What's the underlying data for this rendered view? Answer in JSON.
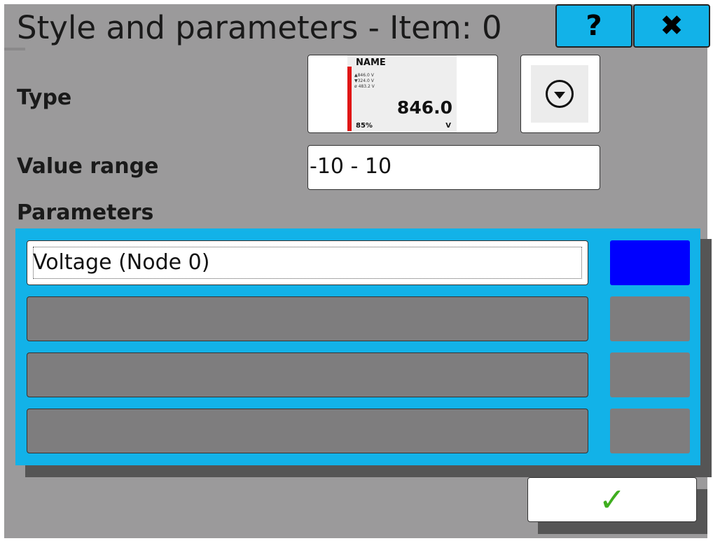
{
  "header": {
    "title": "Style and parameters - Item: 0",
    "help_label": "?",
    "close_label": "✖"
  },
  "type": {
    "label": "Type",
    "preview": {
      "name": "NAME",
      "max": "▲846.0 V",
      "min": "▼324.0 V",
      "avg": "ø 483.2 V",
      "value": "846.0",
      "percent": "85%",
      "unit": "V",
      "bar_fill_fraction": 0.85
    },
    "dropdown_icon": "chevron-down-circle-icon"
  },
  "value_range": {
    "label": "Value range",
    "value": "-10 - 10"
  },
  "parameters": {
    "label": "Parameters",
    "rows": [
      {
        "text": "Voltage (Node 0)",
        "color": "#0000ff"
      },
      {
        "text": "",
        "color": "#7e7d7e"
      },
      {
        "text": "",
        "color": "#7e7d7e"
      },
      {
        "text": "",
        "color": "#7e7d7e"
      }
    ]
  },
  "ok_label": "✓",
  "colors": {
    "accent": "#12b2e8",
    "background": "#9b9a9b",
    "bar": "#e01515",
    "check": "#3fae1f"
  }
}
